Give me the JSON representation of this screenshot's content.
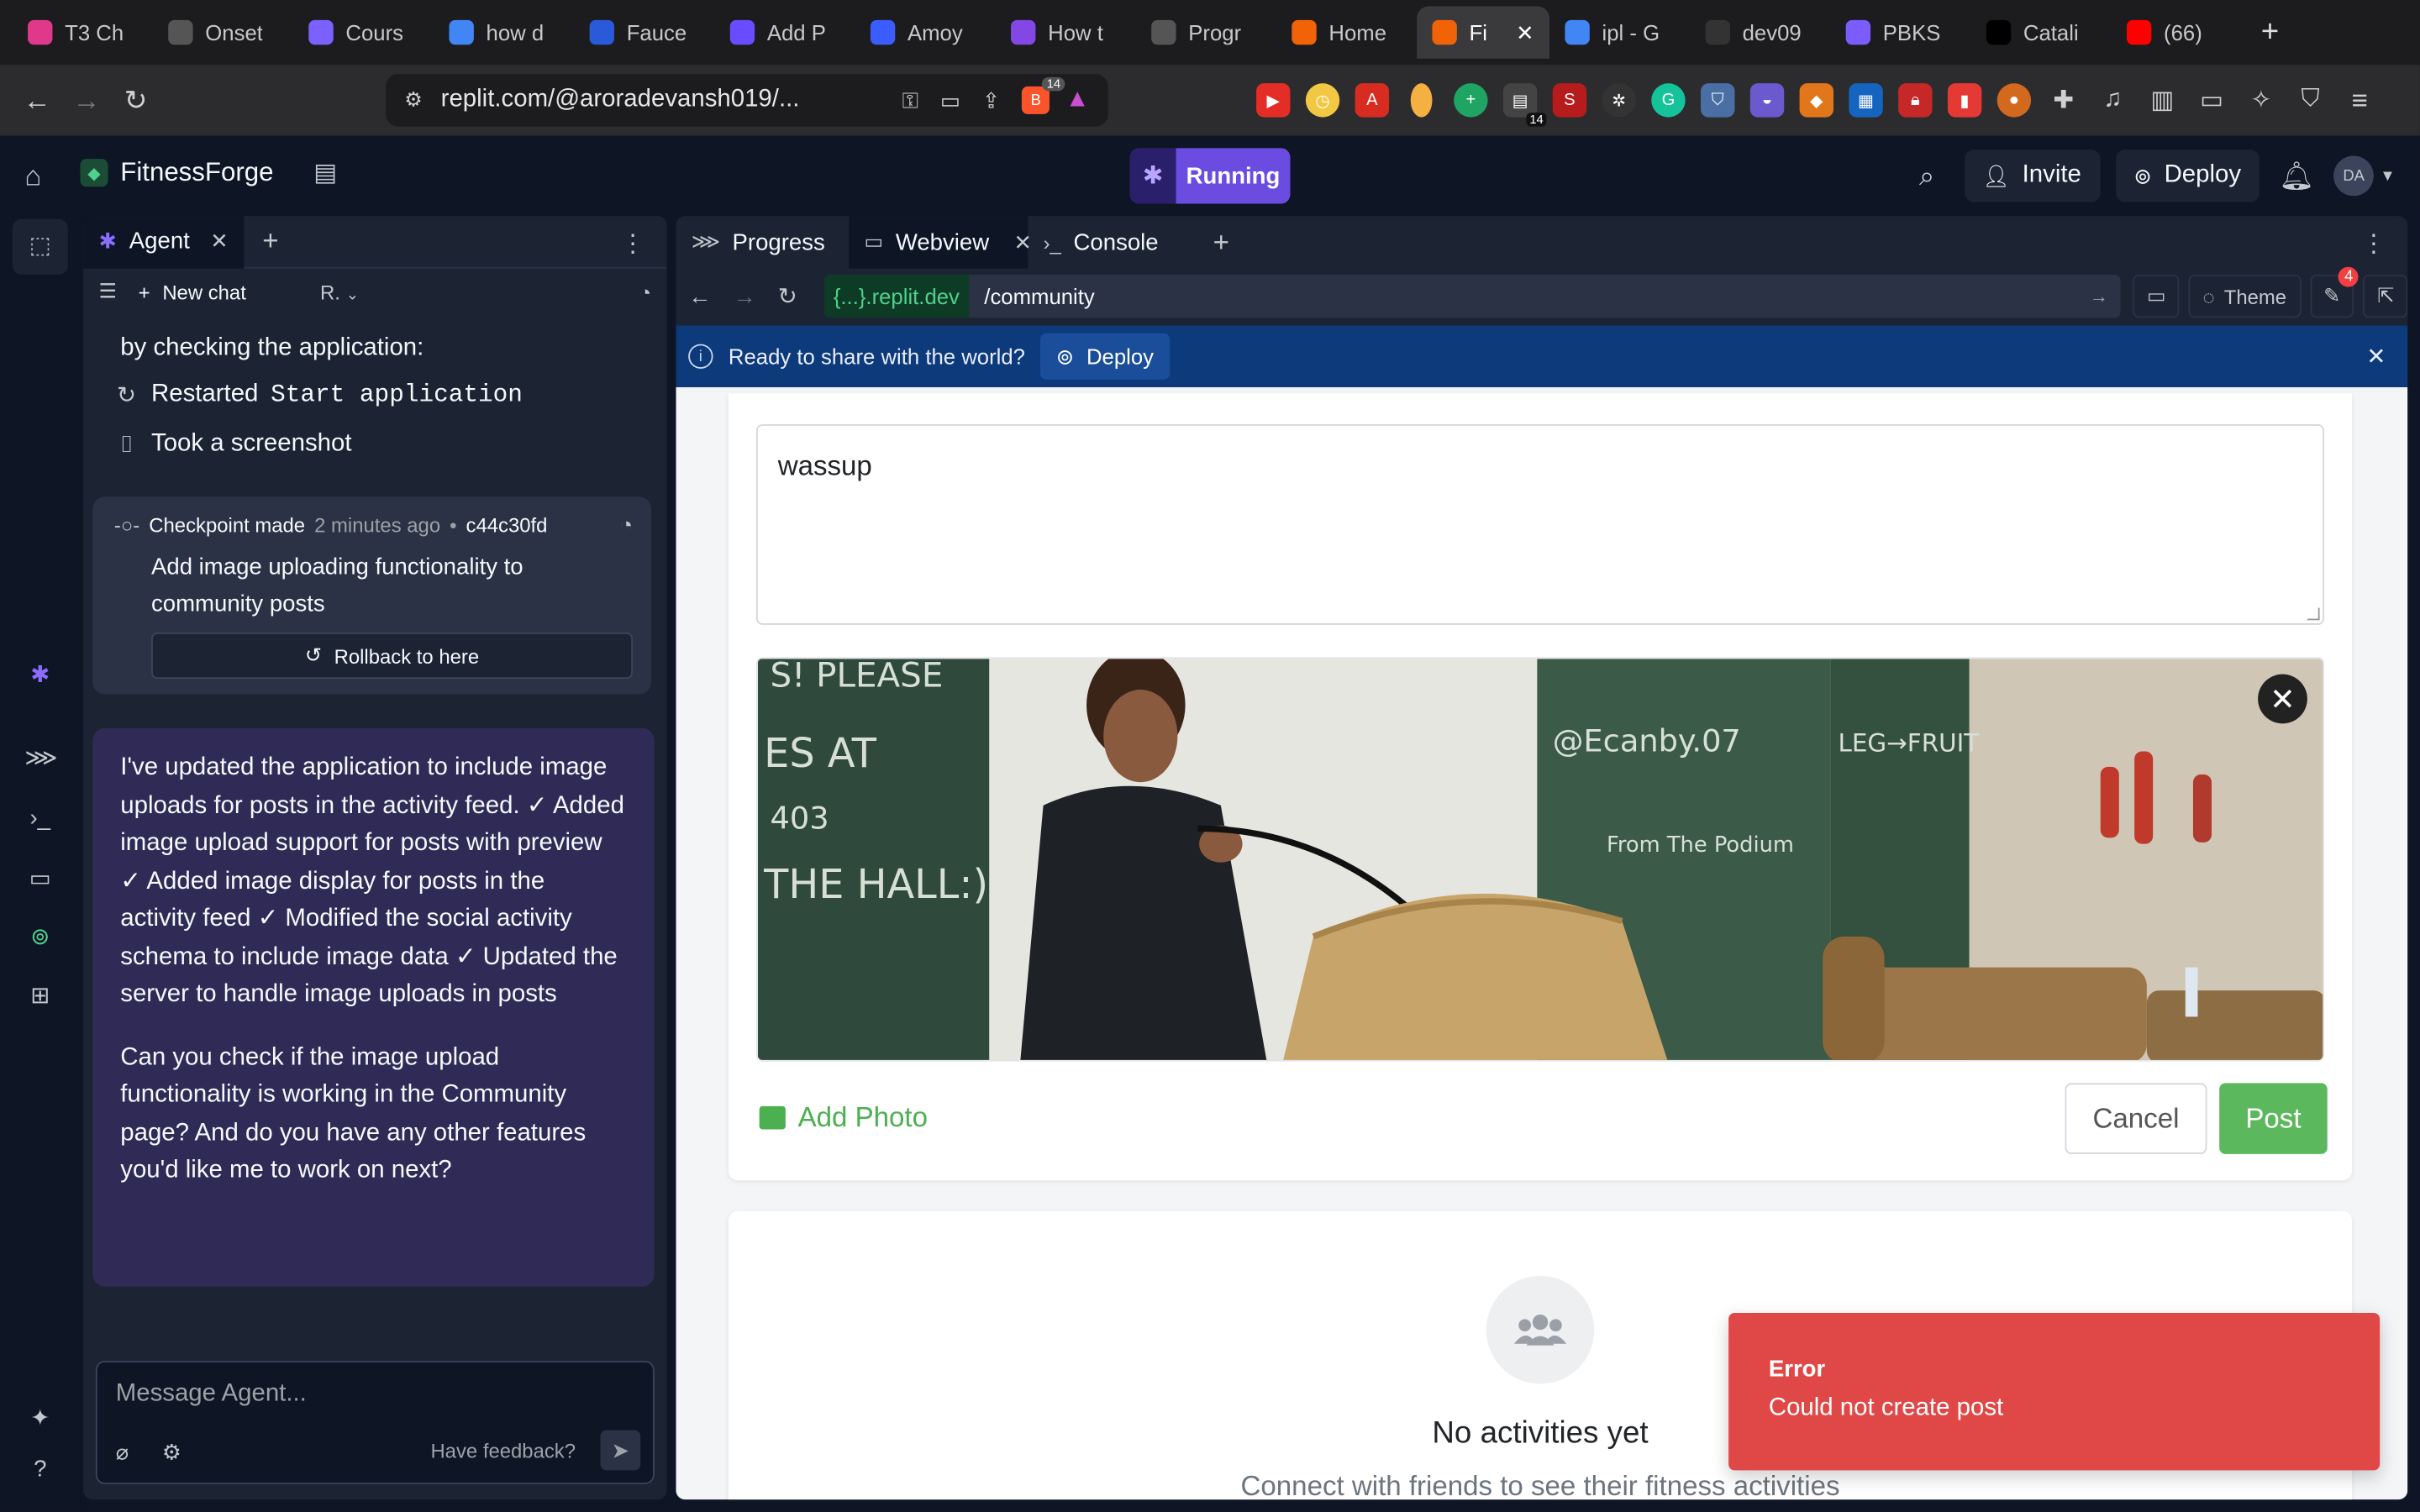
{
  "browser": {
    "tabs": [
      {
        "title": "T3 Ch",
        "icon": "t3-chat-icon",
        "color": "#e0388a"
      },
      {
        "title": "Onset",
        "icon": "openai-icon",
        "color": "#555555"
      },
      {
        "title": "Cours",
        "icon": "solana-icon",
        "color": "#7b61ff"
      },
      {
        "title": "how d",
        "icon": "google-icon",
        "color": "#4285f4"
      },
      {
        "title": "Fauce",
        "icon": "chainlink-icon",
        "color": "#2a5ada"
      },
      {
        "title": "Add P",
        "icon": "link-icon",
        "color": "#6a4cff"
      },
      {
        "title": "Amoy",
        "icon": "polygon-icon",
        "color": "#3b5cff"
      },
      {
        "title": "How t",
        "icon": "polygon-icon",
        "color": "#8247e5"
      },
      {
        "title": "Progr",
        "icon": "openai-icon",
        "color": "#555555"
      },
      {
        "title": "Home",
        "icon": "replit-icon",
        "color": "#f26207"
      },
      {
        "title": "Fi",
        "icon": "replit-icon",
        "color": "#f26207",
        "active": true
      },
      {
        "title": "ipl - G",
        "icon": "google-icon",
        "color": "#4285f4"
      },
      {
        "title": "dev09",
        "icon": "github-icon",
        "color": "#333333"
      },
      {
        "title": "PBKS",
        "icon": "ai-icon",
        "color": "#7b5cff"
      },
      {
        "title": "Catali",
        "icon": "x-icon",
        "color": "#000000"
      },
      {
        "title": "(66)",
        "icon": "youtube-icon",
        "color": "#ff0000"
      }
    ],
    "url": "replit.com/@aroradevansh019/...",
    "brave_count": "14",
    "ext_badge": "14"
  },
  "header": {
    "project_name": "FitnessForge",
    "run_label": "Running",
    "invite_label": "Invite",
    "deploy_label": "Deploy",
    "avatar_initials": "DA"
  },
  "agent": {
    "tab_label": "Agent",
    "new_chat": "New chat",
    "dropdown_label": "R.",
    "cut_text": "by checking the application:",
    "action_restart_prefix": "Restarted",
    "action_restart_mono": "Start application",
    "action_screenshot": "Took a screenshot",
    "checkpoint": {
      "label": "Checkpoint made",
      "time": "2 minutes ago",
      "hash": "c44c30fd",
      "title": "Add image uploading functionality to community posts",
      "rollback": "Rollback to here"
    },
    "message_p1": "I've updated the application to include image uploads for posts in the activity feed. ✓ Added image upload support for posts with preview ✓ Added image display for posts in the activity feed ✓ Modified the social activity schema to include image data ✓ Updated the server to handle image uploads in posts",
    "message_p2": "Can you check if the image upload functionality is working in the Community page? And do you have any other features you'd like me to work on next?",
    "composer_placeholder": "Message Agent...",
    "feedback": "Have feedback?"
  },
  "webview": {
    "tabs": [
      "Progress",
      "Webview",
      "Console"
    ],
    "domain": "{...}.replit.dev",
    "path": "/community",
    "theme_label": "Theme",
    "notif_count": "4",
    "banner_text": "Ready to share with the world?",
    "banner_deploy": "Deploy"
  },
  "page": {
    "post_text": "wassup",
    "add_photo": "Add Photo",
    "cancel": "Cancel",
    "post": "Post",
    "empty_title": "No activities yet",
    "empty_sub": "Connect with friends to see their fitness activities",
    "toast_title": "Error",
    "toast_msg": "Could not create post",
    "photo_board_text": [
      "S! PLEASE",
      "ES  AT",
      "403",
      "THE HALL:)",
      "@Ecanby.07",
      "From The Podium",
      "LEG→FRUIT"
    ]
  }
}
